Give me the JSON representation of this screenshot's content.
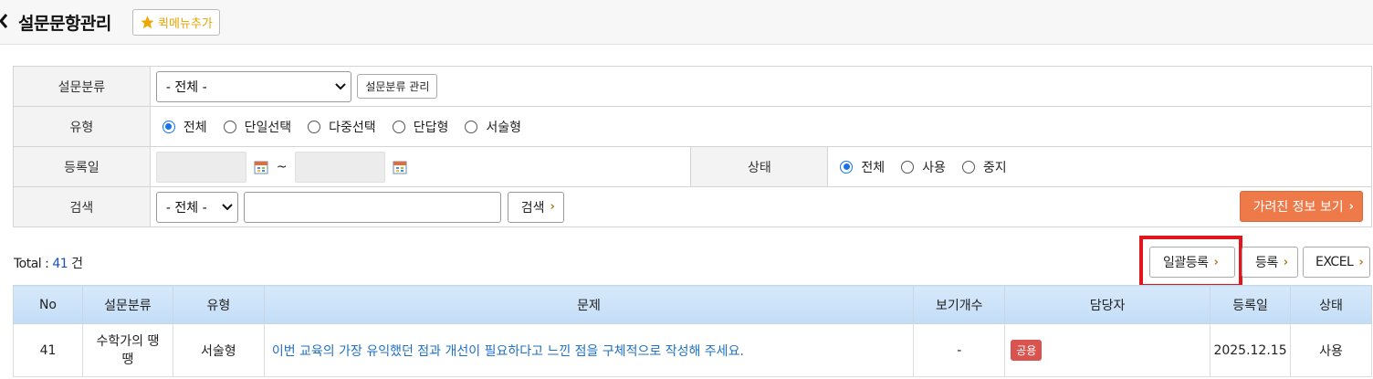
{
  "header": {
    "title": "설문문항관리",
    "quick_menu_label": "퀵메뉴추가"
  },
  "search": {
    "category_label": "설문분류",
    "category_value": "- 전체 -",
    "category_manage_label": "설문분류 관리",
    "type_label": "유형",
    "type_options": [
      "전체",
      "단일선택",
      "다중선택",
      "단답형",
      "서술형"
    ],
    "type_selected": "전체",
    "regdate_label": "등록일",
    "date_separator": "~",
    "status_label": "상태",
    "status_options": [
      "전체",
      "사용",
      "중지"
    ],
    "status_selected": "전체",
    "keyword_label": "검색",
    "keyword_field_value": "- 전체 -",
    "search_button": "검색",
    "hidden_info_button": "가려진 정보 보기"
  },
  "summary": {
    "total_prefix": "Total : ",
    "total_count": "41",
    "total_suffix": " 건"
  },
  "actions": {
    "bulk_register": "일괄등록",
    "register": "등록",
    "excel": "EXCEL"
  },
  "table": {
    "columns": [
      "No",
      "설문분류",
      "유형",
      "문제",
      "보기개수",
      "담당자",
      "등록일",
      "상태"
    ],
    "rows": [
      {
        "no": "41",
        "category": "수학가의 땡땡",
        "type": "서술형",
        "question": "이번 교육의 가장 유익했던 점과 개선이 필요하다고 느낀 점을 구체적으로 작성해 주세요.",
        "option_count": "-",
        "manager": "공용",
        "date": "2025.12.15",
        "status": "사용"
      }
    ]
  },
  "colors": {
    "accent": "#ee7a4a",
    "link": "#1f70c1",
    "highlight": "#e0161c",
    "badge": "#d9534f"
  }
}
